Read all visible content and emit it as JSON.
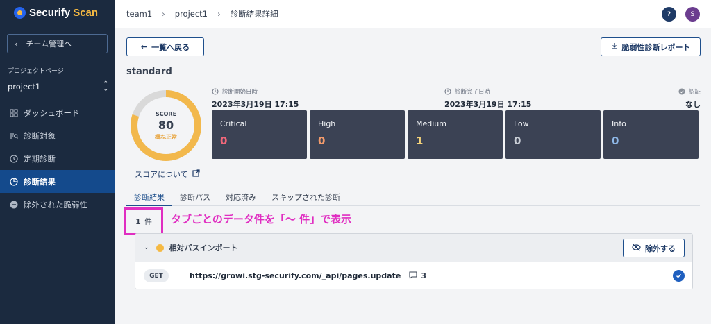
{
  "brand": {
    "name": "Securify",
    "accent": "Scan"
  },
  "sidebar": {
    "back_label": "チーム管理へ",
    "project_page_label": "プロジェクトページ",
    "project_name": "project1",
    "items": [
      {
        "label": "ダッシュボード",
        "icon": "dashboard-icon"
      },
      {
        "label": "診断対象",
        "icon": "target-list-icon"
      },
      {
        "label": "定期診断",
        "icon": "clock-icon"
      },
      {
        "label": "診断結果",
        "icon": "pie-chart-icon",
        "active": true
      },
      {
        "label": "除外された脆弱性",
        "icon": "minus-circle-icon"
      }
    ]
  },
  "header": {
    "breadcrumbs": [
      "team1",
      "project1",
      "診断結果詳細"
    ],
    "help_label": "?",
    "avatar_initial": "S"
  },
  "main": {
    "back_button": "一覧へ戻る",
    "report_button": "脆弱性診断レポート",
    "title": "standard",
    "score": {
      "label": "SCORE",
      "value": "80",
      "status": "概ね正常",
      "fraction": 0.8,
      "link": "スコアについて"
    },
    "meta": {
      "start_label": "診断開始日時",
      "start_value": "2023年3月19日 17:15",
      "end_label": "診断完了日時",
      "end_value": "2023年3月19日 17:15",
      "auth_label": "認証",
      "auth_value": "なし"
    },
    "severity": [
      {
        "name": "Critical",
        "count": "0",
        "color": "#f0677a"
      },
      {
        "name": "High",
        "count": "0",
        "color": "#f29a6b"
      },
      {
        "name": "Medium",
        "count": "1",
        "color": "#f5d37a"
      },
      {
        "name": "Low",
        "count": "0",
        "color": "#c9ced6"
      },
      {
        "name": "Info",
        "count": "0",
        "color": "#8fb8e8"
      }
    ],
    "tabs": [
      "診断結果",
      "診断パス",
      "対応済み",
      "スキップされた診断"
    ],
    "result_count": {
      "number": "1",
      "unit": "件"
    },
    "annotation": "タブごとのデータ件を「〜 件」で表示",
    "group": {
      "title": "相対パスインポート",
      "exclude_button": "除外する",
      "rows": [
        {
          "method": "GET",
          "url": "https://growi.stg-securify.com/_api/pages.update",
          "comments": "3"
        }
      ]
    }
  }
}
